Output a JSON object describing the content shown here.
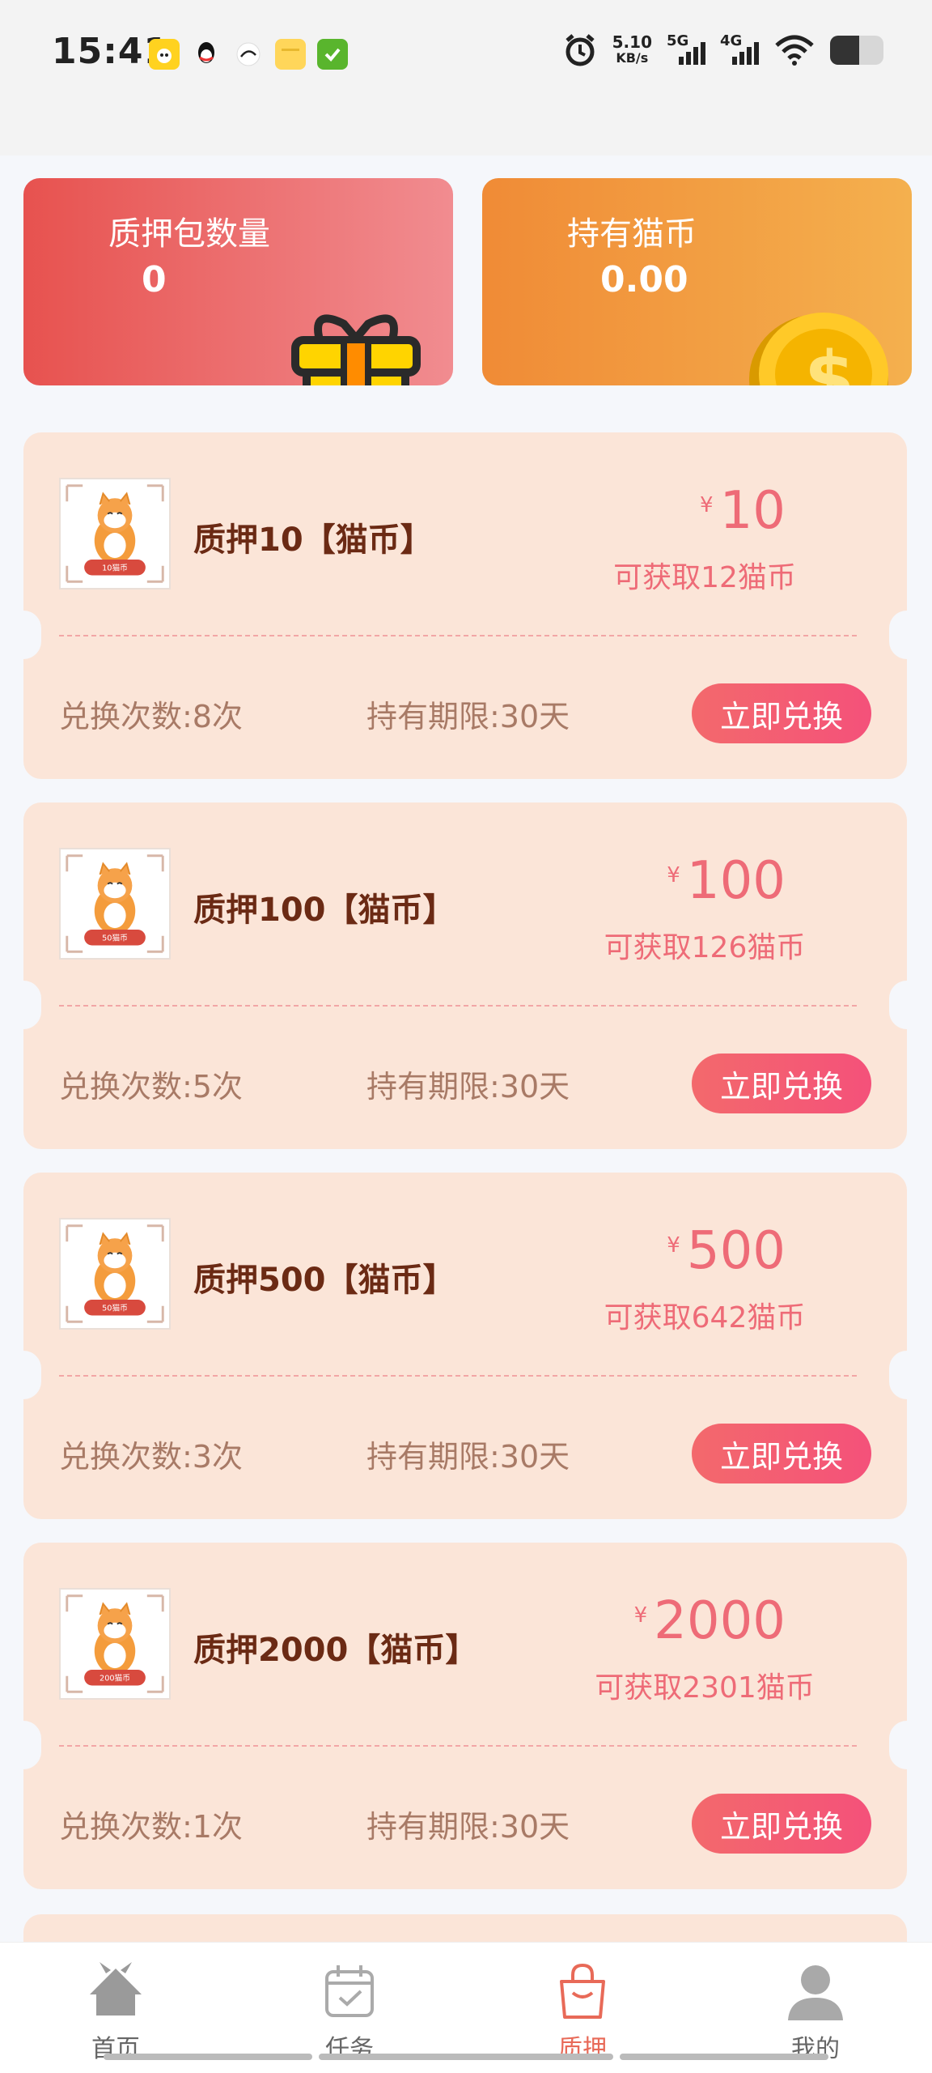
{
  "status_bar": {
    "time": "15:41",
    "net_speed_value": "5.10",
    "net_speed_unit": "KB/s",
    "signal1_label": "5G",
    "signal2_label": "4G",
    "battery_level": 0.55,
    "apps": [
      "photo-app-icon",
      "qq-icon",
      "browser-icon",
      "notes-icon",
      "checkbox-app-icon"
    ]
  },
  "summary": {
    "pledge_count_label": "质押包数量",
    "pledge_count_value": "0",
    "coins_label": "持有猫币",
    "coins_value": "0.00"
  },
  "tickets": [
    {
      "title": "质押10【猫币】",
      "currency": "¥",
      "price": "10",
      "gain": "可获取12猫币",
      "count": "兑换次数:8次",
      "term": "持有期限:30天",
      "button": "立即兑换",
      "badge": "10猫币"
    },
    {
      "title": "质押100【猫币】",
      "currency": "¥",
      "price": "100",
      "gain": "可获取126猫币",
      "count": "兑换次数:5次",
      "term": "持有期限:30天",
      "button": "立即兑换",
      "badge": "50猫币"
    },
    {
      "title": "质押500【猫币】",
      "currency": "¥",
      "price": "500",
      "gain": "可获取642猫币",
      "count": "兑换次数:3次",
      "term": "持有期限:30天",
      "button": "立即兑换",
      "badge": "50猫币"
    },
    {
      "title": "质押2000【猫币】",
      "currency": "¥",
      "price": "2000",
      "gain": "可获取2301猫币",
      "count": "兑换次数:1次",
      "term": "持有期限:30天",
      "button": "立即兑换",
      "badge": "200猫币"
    }
  ],
  "nav": {
    "items": [
      {
        "label": "首页",
        "icon": "home-icon"
      },
      {
        "label": "任务",
        "icon": "calendar-icon"
      },
      {
        "label": "质押",
        "icon": "bag-icon"
      },
      {
        "label": "我的",
        "icon": "user-icon"
      }
    ],
    "active_index": 2
  },
  "colors": {
    "accent": "#ee6b77",
    "title_brown": "#6b2a14",
    "ticket_bg": "#fbe5d8",
    "nav_active": "#e86a58"
  }
}
